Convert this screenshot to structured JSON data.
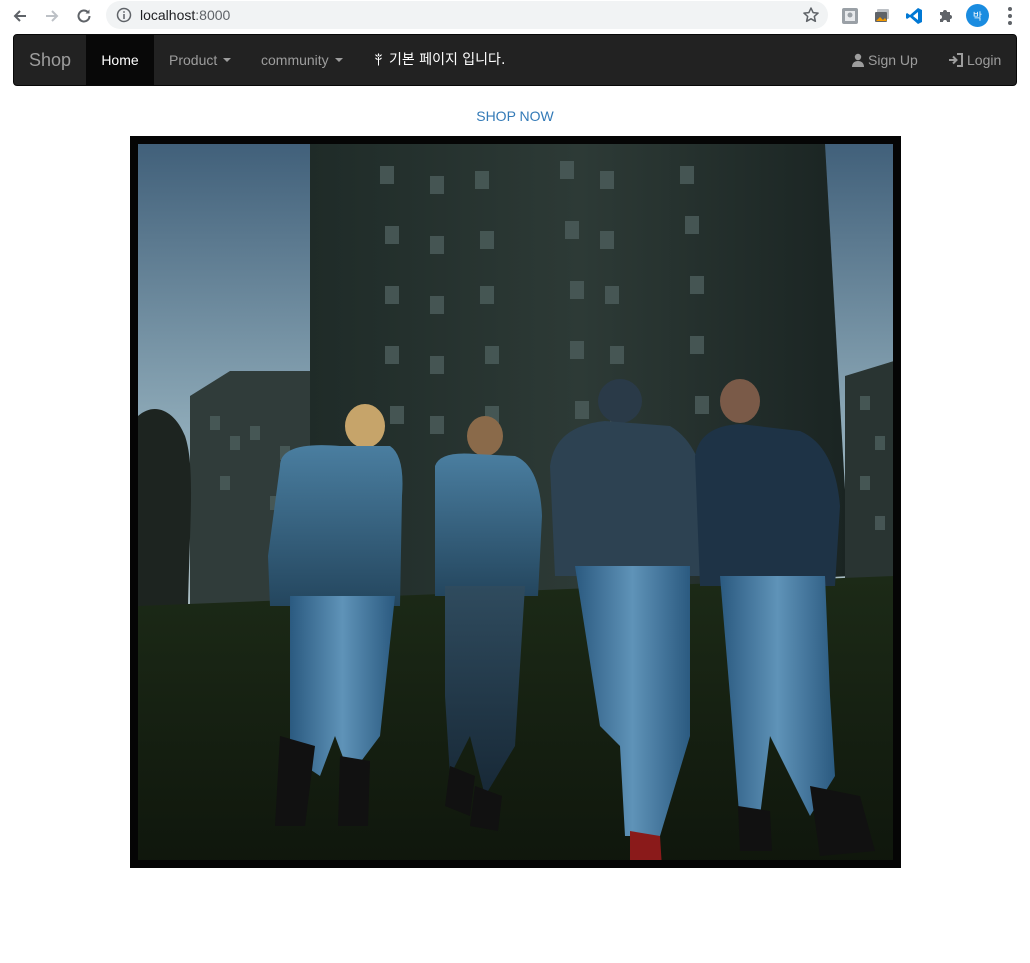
{
  "browser": {
    "url_host": "localhost",
    "url_port": ":8000",
    "profile_initial": "박"
  },
  "navbar": {
    "brand": "Shop",
    "items": [
      {
        "label": "Home",
        "active": true
      },
      {
        "label": "Product",
        "dropdown": true
      },
      {
        "label": "community",
        "dropdown": true
      }
    ],
    "message": "기본 페이지 입니다.",
    "message_icon": "grain-icon",
    "signup": "Sign Up",
    "login": "Login"
  },
  "main": {
    "shop_now": "SHOP NOW",
    "hero_image": "four people in denim jackets and jeans walking toward a high-rise apartment building at dusk"
  },
  "colors": {
    "navbar_bg": "#222222",
    "navbar_active": "#080808",
    "link": "#337ab7",
    "profile": "#1a8ce0"
  }
}
